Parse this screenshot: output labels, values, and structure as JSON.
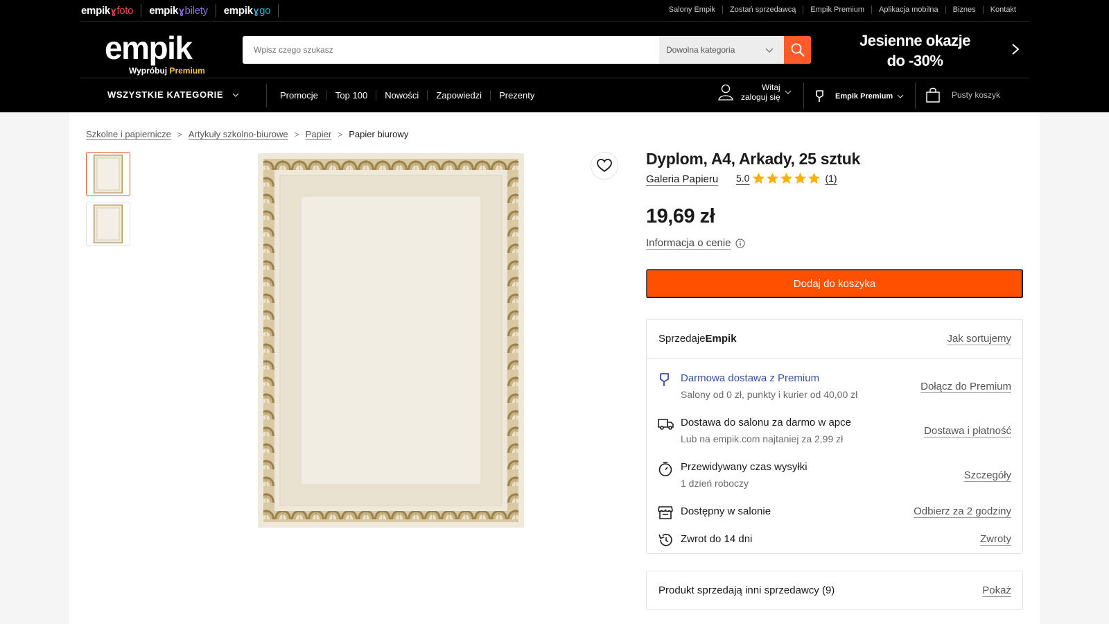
{
  "topbar": {
    "brands": [
      {
        "prefix": "empik",
        "suffix": "foto",
        "color": "#e5484d"
      },
      {
        "prefix": "empik",
        "suffix": "bilety",
        "color": "#8e6ee8"
      },
      {
        "prefix": "empik",
        "suffix": "go",
        "color": "#2ba8c8"
      }
    ],
    "links": [
      "Salony Empik",
      "Zostań sprzedawcą",
      "Empik Premium",
      "Aplikacja mobilna",
      "Biznes",
      "Kontakt"
    ]
  },
  "logo": {
    "text": "empik",
    "sub_prefix": "Wypróbuj ",
    "sub_premium": "Premium"
  },
  "search": {
    "placeholder": "Wpisz czego szukasz",
    "category": "Dowolna kategoria"
  },
  "promo": {
    "line1": "Jesienne okazje",
    "line2": "do -30%"
  },
  "nav": {
    "all_categories": "WSZYSTKIE KATEGORIE",
    "links": [
      "Promocje",
      "Top 100",
      "Nowości",
      "Zapowiedzi",
      "Prezenty"
    ],
    "account_line1": "Witaj",
    "account_line2": "zaloguj się",
    "premium": "Empik Premium",
    "cart": "Pusty koszyk"
  },
  "breadcrumb": {
    "items": [
      "Szkolne i papiernicze",
      "Artykuły szkolno-biurowe",
      "Papier"
    ],
    "current": "Papier biurowy",
    "separator": ">"
  },
  "product": {
    "title": "Dyplom, A4, Arkady, 25 sztuk",
    "brand": "Galeria Papieru",
    "rating": "5.0",
    "rating_stars": 5,
    "rating_count": "(1)",
    "price": "19,69 zł",
    "price_info": "Informacja o cenie",
    "add_to_cart": "Dodaj do koszyka"
  },
  "seller_box": {
    "label_prefix": "Sprzedaje",
    "seller": "Empik",
    "sort_link": "Jak sortujemy",
    "rows": [
      {
        "icon": "premium-icon",
        "title": "Darmowa dostawa z Premium",
        "sub": "Salony od 0 zł, punkty i kurier od 40,00 zł",
        "link": "Dołącz do Premium"
      },
      {
        "icon": "truck-icon",
        "title": "Dostawa do salonu za darmo w apce",
        "sub": "Lub na empik.com najtaniej za 2,99 zł",
        "link": "Dostawa i płatność"
      },
      {
        "icon": "stopwatch-icon",
        "title": "Przewidywany czas wysyłki",
        "sub": "1 dzień roboczy",
        "link": "Szczegóły"
      },
      {
        "icon": "store-icon",
        "title": "Dostępny w salonie",
        "sub": "",
        "link": "Odbierz za 2 godziny"
      },
      {
        "icon": "return-icon",
        "title": "Zwrot do 14 dni",
        "sub": "",
        "link": "Zwroty"
      }
    ]
  },
  "others_box": {
    "label": "Produkt sprzedają inni sprzedawcy (9)",
    "link": "Pokaż"
  },
  "colors": {
    "accent": "#ff5000",
    "search_button": "#ff5a29",
    "premium_blue": "#3a4f9e",
    "star": "#f4b400",
    "header_bg": "#000000",
    "certificate_gold": "#b49a5e"
  }
}
